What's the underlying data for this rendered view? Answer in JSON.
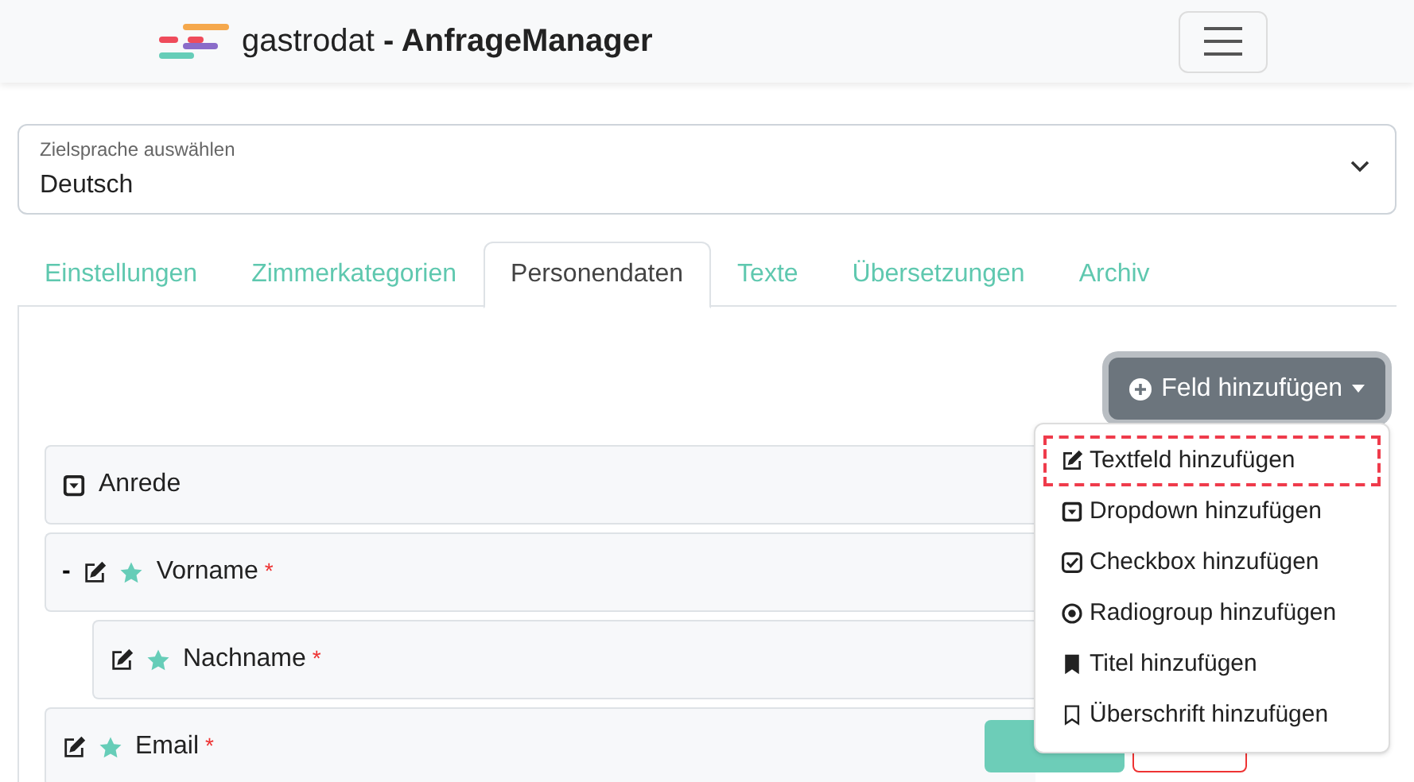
{
  "header": {
    "brand_light": "gastrodat",
    "brand_bold": "- AnfrageManager"
  },
  "language_select": {
    "label": "Zielsprache auswählen",
    "value": "Deutsch"
  },
  "tabs": [
    {
      "label": "Einstellungen",
      "selected": false
    },
    {
      "label": "Zimmerkategorien",
      "selected": false
    },
    {
      "label": "Personendaten",
      "selected": true
    },
    {
      "label": "Texte",
      "selected": false
    },
    {
      "label": "Übersetzungen",
      "selected": false
    },
    {
      "label": "Archiv",
      "selected": false
    }
  ],
  "add_field_button": {
    "label": "Feld hinzufügen",
    "expanded": true
  },
  "fields": [
    {
      "kind": "dropdown",
      "label": "Anrede",
      "required": false
    },
    {
      "kind": "text",
      "label": "Vorname",
      "required": true,
      "asterisk": "*",
      "prefix": "-",
      "children": [
        {
          "kind": "text",
          "label": "Nachname",
          "required": true,
          "asterisk": "*"
        }
      ]
    },
    {
      "kind": "text",
      "label": "Email",
      "required": true,
      "asterisk": "*",
      "buttons": true
    }
  ],
  "menu": [
    {
      "kind": "text",
      "label": "Textfeld hinzufügen",
      "selected": true
    },
    {
      "kind": "dropdown",
      "label": "Dropdown hinzufügen",
      "selected": false
    },
    {
      "kind": "checkbox",
      "label": "Checkbox hinzufügen",
      "selected": false
    },
    {
      "kind": "radio",
      "label": "Radiogroup hinzufügen",
      "selected": false
    },
    {
      "kind": "title",
      "label": "Titel hinzufügen",
      "selected": false
    },
    {
      "kind": "heading",
      "label": "Überschrift hinzufügen",
      "selected": false
    }
  ]
}
